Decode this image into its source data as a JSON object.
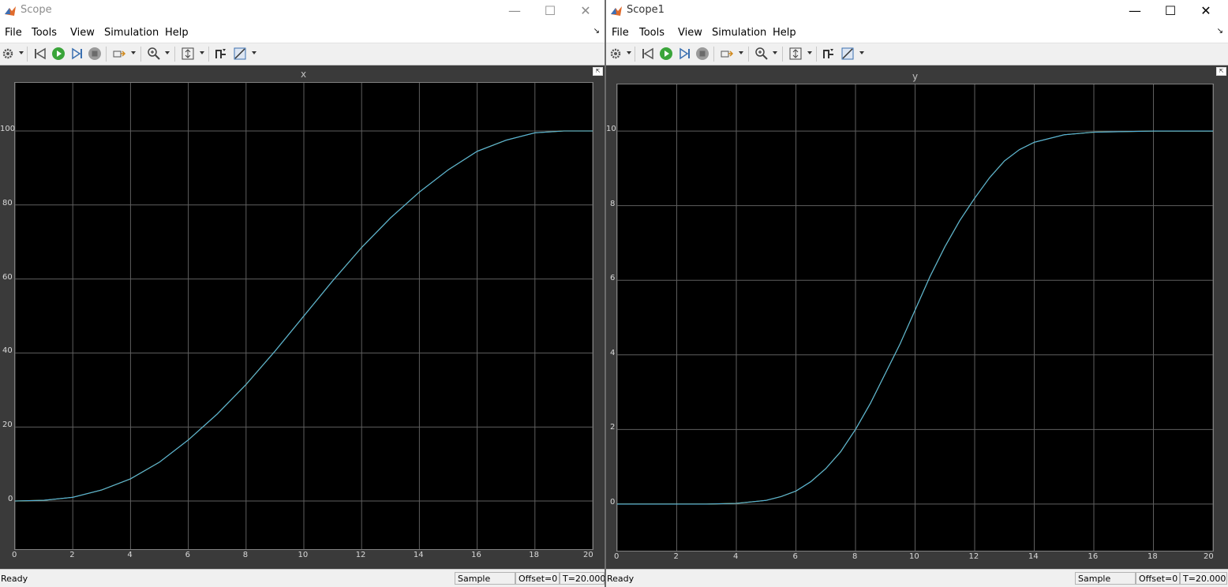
{
  "windows": [
    {
      "title": "Scope",
      "menu": [
        "File",
        "Tools",
        "View",
        "Simulation",
        "Help"
      ],
      "axes_title": "x",
      "status": {
        "ready": "Ready",
        "sample": "Sample based",
        "offset": "Offset=0",
        "time": "T=20.000"
      }
    },
    {
      "title": "Scope1",
      "menu": [
        "File",
        "Tools",
        "View",
        "Simulation",
        "Help"
      ],
      "axes_title": "y",
      "status": {
        "ready": "Ready",
        "sample": "Sample based",
        "offset": "Offset=0",
        "time": "T=20.000"
      }
    }
  ],
  "window_controls": {
    "minimize": "—",
    "maximize": "☐",
    "close": "✕"
  },
  "undock_glyph": "⇱",
  "colors": {
    "background": "#000000",
    "grid": "#5f5f5f",
    "trace": "#4fb0e0",
    "trace_alt": "#ffff44",
    "frame": "#f0f0f0"
  },
  "chart_data": [
    {
      "type": "line",
      "title": "x",
      "xlim": [
        0,
        20
      ],
      "ylim": [
        -13,
        113
      ],
      "xticks": [
        0,
        2,
        4,
        6,
        8,
        10,
        12,
        14,
        16,
        18,
        20
      ],
      "yticks": [
        0,
        20,
        40,
        60,
        80,
        100
      ],
      "grid": true,
      "series": [
        {
          "x": [
            0,
            1,
            2,
            3,
            4,
            5,
            6,
            7,
            8,
            9,
            10,
            11,
            12,
            13,
            14,
            15,
            16,
            17,
            18,
            19,
            20
          ],
          "y": [
            0,
            0.2,
            1,
            3,
            6,
            10.5,
            16.5,
            23.5,
            31.5,
            40.5,
            50,
            59.5,
            68.5,
            76.5,
            83.5,
            89.5,
            94.5,
            97.5,
            99.5,
            100,
            100
          ]
        }
      ]
    },
    {
      "type": "line",
      "title": "y",
      "xlim": [
        0,
        20
      ],
      "ylim": [
        -1.25,
        11.25
      ],
      "xticks": [
        0,
        2,
        4,
        6,
        8,
        10,
        12,
        14,
        16,
        18,
        20
      ],
      "yticks": [
        0,
        2,
        4,
        6,
        8,
        10
      ],
      "grid": true,
      "series": [
        {
          "x": [
            0,
            2,
            3,
            4,
            5,
            5.5,
            6,
            6.5,
            7,
            7.5,
            8,
            8.5,
            9,
            9.5,
            10,
            10.5,
            11,
            11.5,
            12,
            12.5,
            13,
            13.5,
            14,
            15,
            16,
            18,
            20
          ],
          "y": [
            0,
            0,
            0,
            0.02,
            0.1,
            0.2,
            0.35,
            0.6,
            0.95,
            1.4,
            2,
            2.7,
            3.5,
            4.3,
            5.2,
            6.1,
            6.9,
            7.6,
            8.2,
            8.75,
            9.2,
            9.5,
            9.7,
            9.9,
            9.97,
            10,
            10
          ]
        }
      ]
    }
  ]
}
